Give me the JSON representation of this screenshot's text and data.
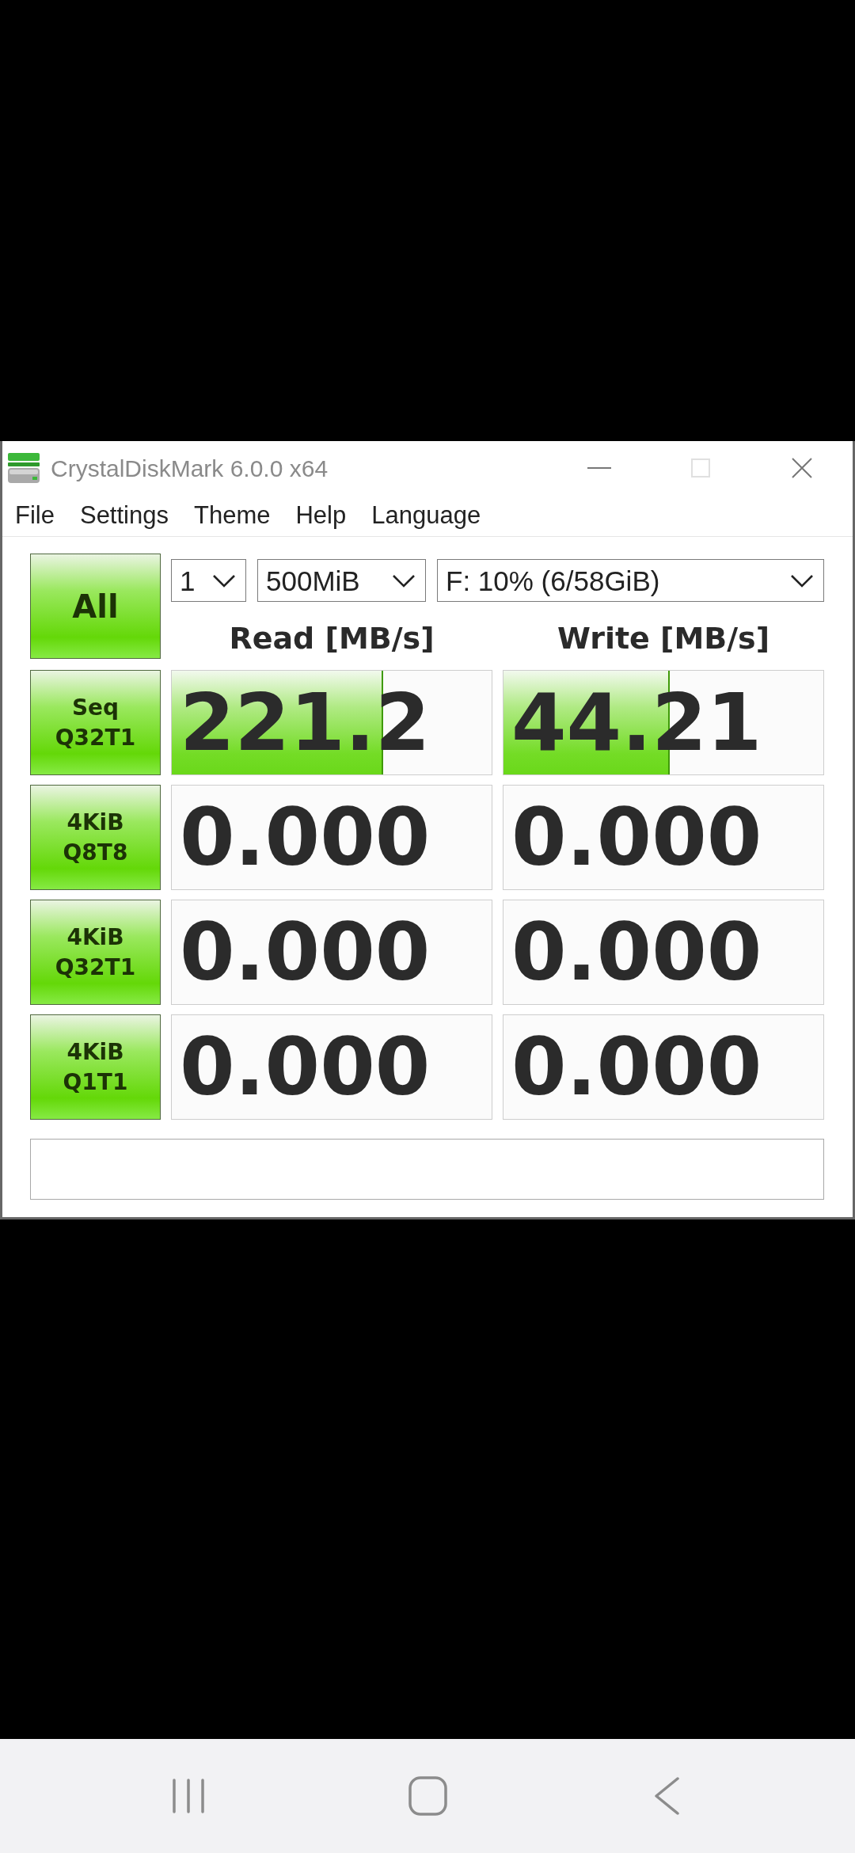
{
  "window": {
    "title": "CrystalDiskMark 6.0.0 x64",
    "maximize_disabled": true
  },
  "menu": [
    "File",
    "Settings",
    "Theme",
    "Help",
    "Language"
  ],
  "all_button": "All",
  "dropdowns": [
    {
      "value": "1"
    },
    {
      "value": "500MiB"
    },
    {
      "value": "F: 10% (6/58GiB)"
    }
  ],
  "headers": [
    "Read [MB/s]",
    "Write [MB/s]"
  ],
  "rows": [
    {
      "label": "Seq\nQ32T1",
      "read": {
        "value": "221.2",
        "level": 0.66
      },
      "write": {
        "value": "44.21",
        "level": 0.52
      }
    },
    {
      "label": "4KiB\nQ8T8",
      "read": {
        "value": "0.000"
      },
      "write": {
        "value": "0.000"
      }
    },
    {
      "label": "4KiB\nQ32T1",
      "read": {
        "value": "0.000"
      },
      "write": {
        "value": "0.000"
      }
    },
    {
      "label": "4KiB\nQ1T1",
      "read": {
        "value": "0.000"
      },
      "write": {
        "value": "0.000"
      }
    }
  ]
}
